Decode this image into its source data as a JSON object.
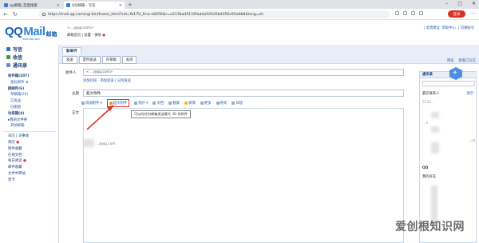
{
  "browser": {
    "tabs": [
      {
        "label": "qq邮箱_百度搜索",
        "active": false
      },
      {
        "label": "QQ邮箱 - 写信",
        "active": true
      }
    ],
    "url": "https://mail.qq.com/cgi-bin/frame_html?sid=fb17U_fme-e8056&r=a213bad5116fadda505d5b4056c95a0b8&lang=zh",
    "login_label": "登录",
    "more_icon": "more-icon"
  },
  "header": {
    "logo_text": "Mail",
    "logo_prefix": "QQ",
    "logo_cn": "邮箱",
    "logo_sub": "mail.qq.com",
    "account": "<…@qq.com>",
    "top_links": "邮箱首页 | 设置 - 换肤",
    "right_links": [
      "| 反馈建议",
      "帮助中心",
      "| 切换账号"
    ]
  },
  "sidebar": {
    "buttons": [
      {
        "label": "写信",
        "icon": "pen-icon"
      },
      {
        "label": "收信",
        "icon": "inbox-icon"
      },
      {
        "label": "通讯录",
        "icon": "contacts-icon"
      }
    ],
    "folders": [
      {
        "label": "收件箱(207)",
        "bold": true
      },
      {
        "label": "星标邮件 ★",
        "bold": false
      },
      {
        "label": "群邮件(6)",
        "bold": true
      },
      {
        "label": "草稿箱(20)",
        "bold": false
      },
      {
        "label": "已发送",
        "bold": false
      },
      {
        "label": "已删除",
        "bold": false
      },
      {
        "label": "垃圾箱(4)",
        "bold": true
      },
      {
        "label": "QQ邮件订阅",
        "bold": false
      },
      {
        "label": "其他邮箱",
        "bold": false
      },
      {
        "label": "日历 | 记事本",
        "bold": false
      },
      {
        "label": "简历",
        "bold": false
      },
      {
        "label": "附件收藏",
        "bold": false
      },
      {
        "label": "在线文档",
        "bold": false
      },
      {
        "label": "每日阅读",
        "bold": false
      },
      {
        "label": "邮件收藏",
        "bold": false
      },
      {
        "label": "文件中转站",
        "bold": false
      },
      {
        "label": "贺卡",
        "bold": false
      }
    ],
    "other_mail_label": "▸我的文件夹"
  },
  "compose": {
    "title": "新邮件",
    "actions": [
      "发送",
      "定时发送",
      "存草稿",
      "关闭"
    ],
    "right_actions": [
      "预览",
      "新窗口写信"
    ],
    "to_label": "收件人",
    "to_value": "< …@qq.com>",
    "to_links": "添加抄送 - 添加密送 | 分别发送",
    "subject_label": "主题",
    "subject_value": "超大附件",
    "body_label": "正文",
    "toolbar": [
      "添加附件",
      "超大附件",
      "照片",
      "文档",
      "截屏",
      "表情",
      "更多",
      "格式",
      "日程"
    ],
    "tooltip": "可以向任何邮箱发送最大 3G 的附件",
    "signature_hint": "…@qq.com"
  },
  "contacts": {
    "tab": "通讯录",
    "recent_label": "最近联系人",
    "recent_action": "清空",
    "row_a": "5532…",
    "row_b": "…3",
    "row_c": "…zd",
    "qq_label": "QQ",
    "friends_label": "我的好友"
  },
  "watermark": "爱创根知识网"
}
